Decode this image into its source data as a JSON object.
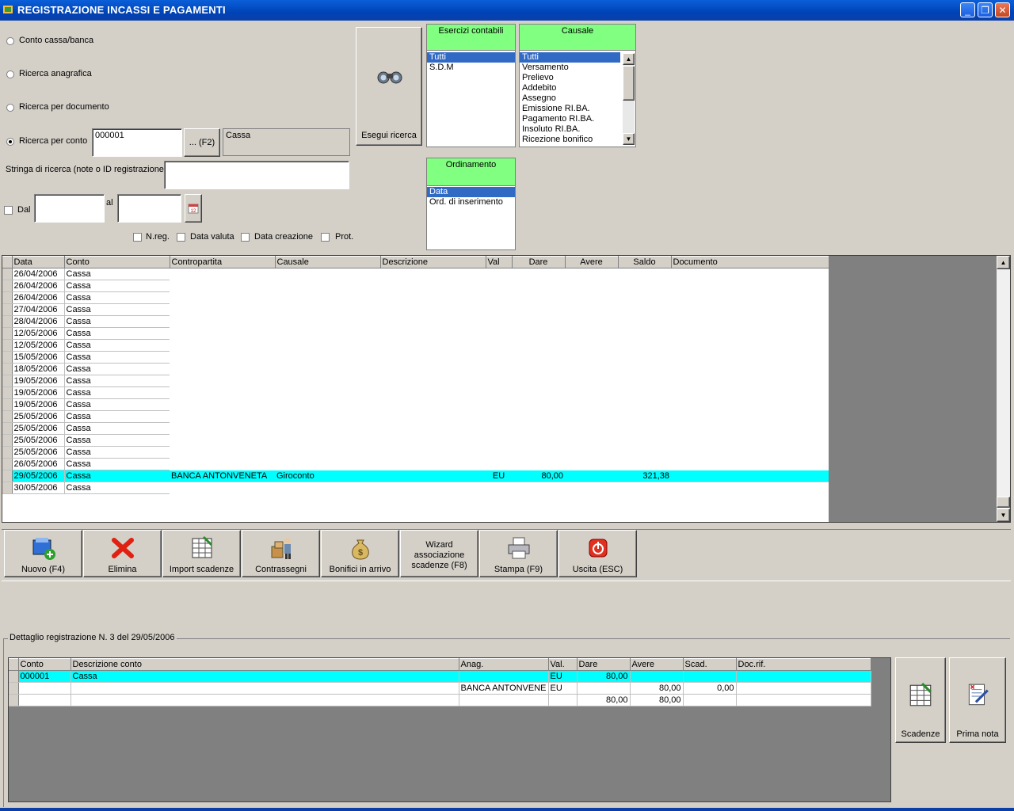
{
  "window": {
    "title": "REGISTRAZIONE INCASSI E PAGAMENTI"
  },
  "search": {
    "options": [
      "Conto cassa/banca",
      "Ricerca anagrafica",
      "Ricerca per documento",
      "Ricerca per conto"
    ],
    "selected_option": "Ricerca per conto",
    "conto_code": "000001",
    "f2_label": "... (F2)",
    "conto_name": "Cassa",
    "string_label": "Stringa di ricerca (note o ID registrazione)",
    "string_value": "",
    "dal_label": "Dal",
    "al_label": "al",
    "checks": [
      "N.reg.",
      "Data valuta",
      "Data creazione",
      "Prot."
    ],
    "run_label": "Esegui ricerca"
  },
  "esercizi": {
    "header": "Esercizi contabili",
    "items": [
      "Tutti",
      "S.D.M"
    ],
    "selected": "Tutti"
  },
  "causale": {
    "header": "Causale",
    "items": [
      "Tutti",
      "Versamento",
      "Prelievo",
      "Addebito",
      "Assegno",
      "Emissione RI.BA.",
      "Pagamento RI.BA.",
      "Insoluto RI.BA.",
      "Ricezione bonifico"
    ],
    "selected": "Tutti"
  },
  "ordinamento": {
    "header": "Ordinamento",
    "items": [
      "Data",
      "Ord. di inserimento"
    ],
    "selected": "Data"
  },
  "grid": {
    "columns": [
      "Data",
      "Conto",
      "Contropartita",
      "Causale",
      "Descrizione",
      "Val",
      "Dare",
      "Avere",
      "Saldo",
      "Documento"
    ],
    "rows": [
      {
        "data": "26/04/2006",
        "conto": "Cassa"
      },
      {
        "data": "26/04/2006",
        "conto": "Cassa"
      },
      {
        "data": "26/04/2006",
        "conto": "Cassa"
      },
      {
        "data": "27/04/2006",
        "conto": "Cassa"
      },
      {
        "data": "28/04/2006",
        "conto": "Cassa"
      },
      {
        "data": "12/05/2006",
        "conto": "Cassa"
      },
      {
        "data": "12/05/2006",
        "conto": "Cassa"
      },
      {
        "data": "15/05/2006",
        "conto": "Cassa"
      },
      {
        "data": "18/05/2006",
        "conto": "Cassa"
      },
      {
        "data": "19/05/2006",
        "conto": "Cassa"
      },
      {
        "data": "19/05/2006",
        "conto": "Cassa"
      },
      {
        "data": "19/05/2006",
        "conto": "Cassa"
      },
      {
        "data": "25/05/2006",
        "conto": "Cassa"
      },
      {
        "data": "25/05/2006",
        "conto": "Cassa"
      },
      {
        "data": "25/05/2006",
        "conto": "Cassa"
      },
      {
        "data": "25/05/2006",
        "conto": "Cassa"
      },
      {
        "data": "26/05/2006",
        "conto": "Cassa"
      },
      {
        "data": "29/05/2006",
        "conto": "Cassa",
        "contropartita": "BANCA ANTONVENETA",
        "causale": "Giroconto",
        "val": "EU",
        "dare": "80,00",
        "saldo": "321,38",
        "selected": true
      },
      {
        "data": "30/05/2006",
        "conto": "Cassa"
      }
    ]
  },
  "toolbar": {
    "buttons": [
      "Nuovo (F4)",
      "Elimina",
      "Import scadenze",
      "Contrassegni",
      "Bonifici in arrivo",
      "Wizard associazione scadenze (F8)",
      "Stampa (F9)",
      "Uscita (ESC)"
    ]
  },
  "detail": {
    "title": "Dettaglio registrazione N. 3 del 29/05/2006",
    "columns": [
      "Conto",
      "Descrizione conto",
      "Anag.",
      "Val.",
      "Dare",
      "Avere",
      "Scad.",
      "Doc.rif."
    ],
    "rows": [
      {
        "conto": "000001",
        "descrizione": "Cassa",
        "anag": "",
        "val": "EU",
        "dare": "80,00",
        "avere": "",
        "scad": "",
        "docrif": "",
        "selected": true
      },
      {
        "conto": "",
        "descrizione": "",
        "anag": "BANCA ANTONVENE",
        "val": "EU",
        "dare": "",
        "avere": "80,00",
        "scad": "0,00",
        "docrif": ""
      },
      {
        "conto": "",
        "descrizione": "",
        "anag": "",
        "val": "",
        "dare": "80,00",
        "avere": "80,00",
        "scad": "",
        "docrif": ""
      }
    ],
    "side_buttons": [
      "Scadenze",
      "Prima nota"
    ]
  }
}
